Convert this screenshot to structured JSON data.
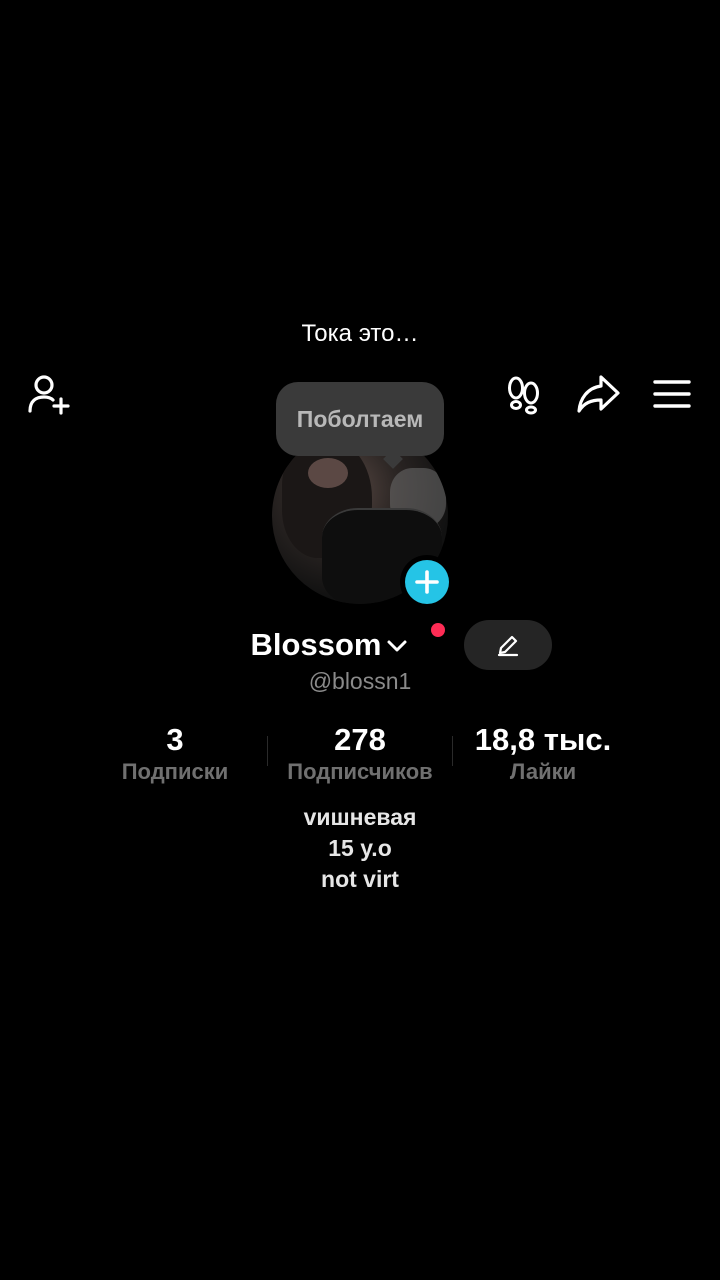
{
  "caption": "Тока это…",
  "toolbar": {
    "add_friend_icon": "add-user-icon",
    "footprints_icon": "footprints-icon",
    "share_icon": "share-icon",
    "menu_icon": "hamburger-menu-icon"
  },
  "bubble": {
    "label": "Поболтаем"
  },
  "profile": {
    "display_name": "Blossom",
    "username": "@blossn1",
    "status_dot_color": "#fe2c55",
    "add_badge_color": "#25c4e6"
  },
  "stats": [
    {
      "value": "3",
      "label": "Подписки"
    },
    {
      "value": "278",
      "label": "Подписчиков"
    },
    {
      "value": "18,8 тыс.",
      "label": "Лайки"
    }
  ],
  "bio": {
    "line1": "vишневая",
    "line2": "15 y.o",
    "line3": "not virt"
  }
}
